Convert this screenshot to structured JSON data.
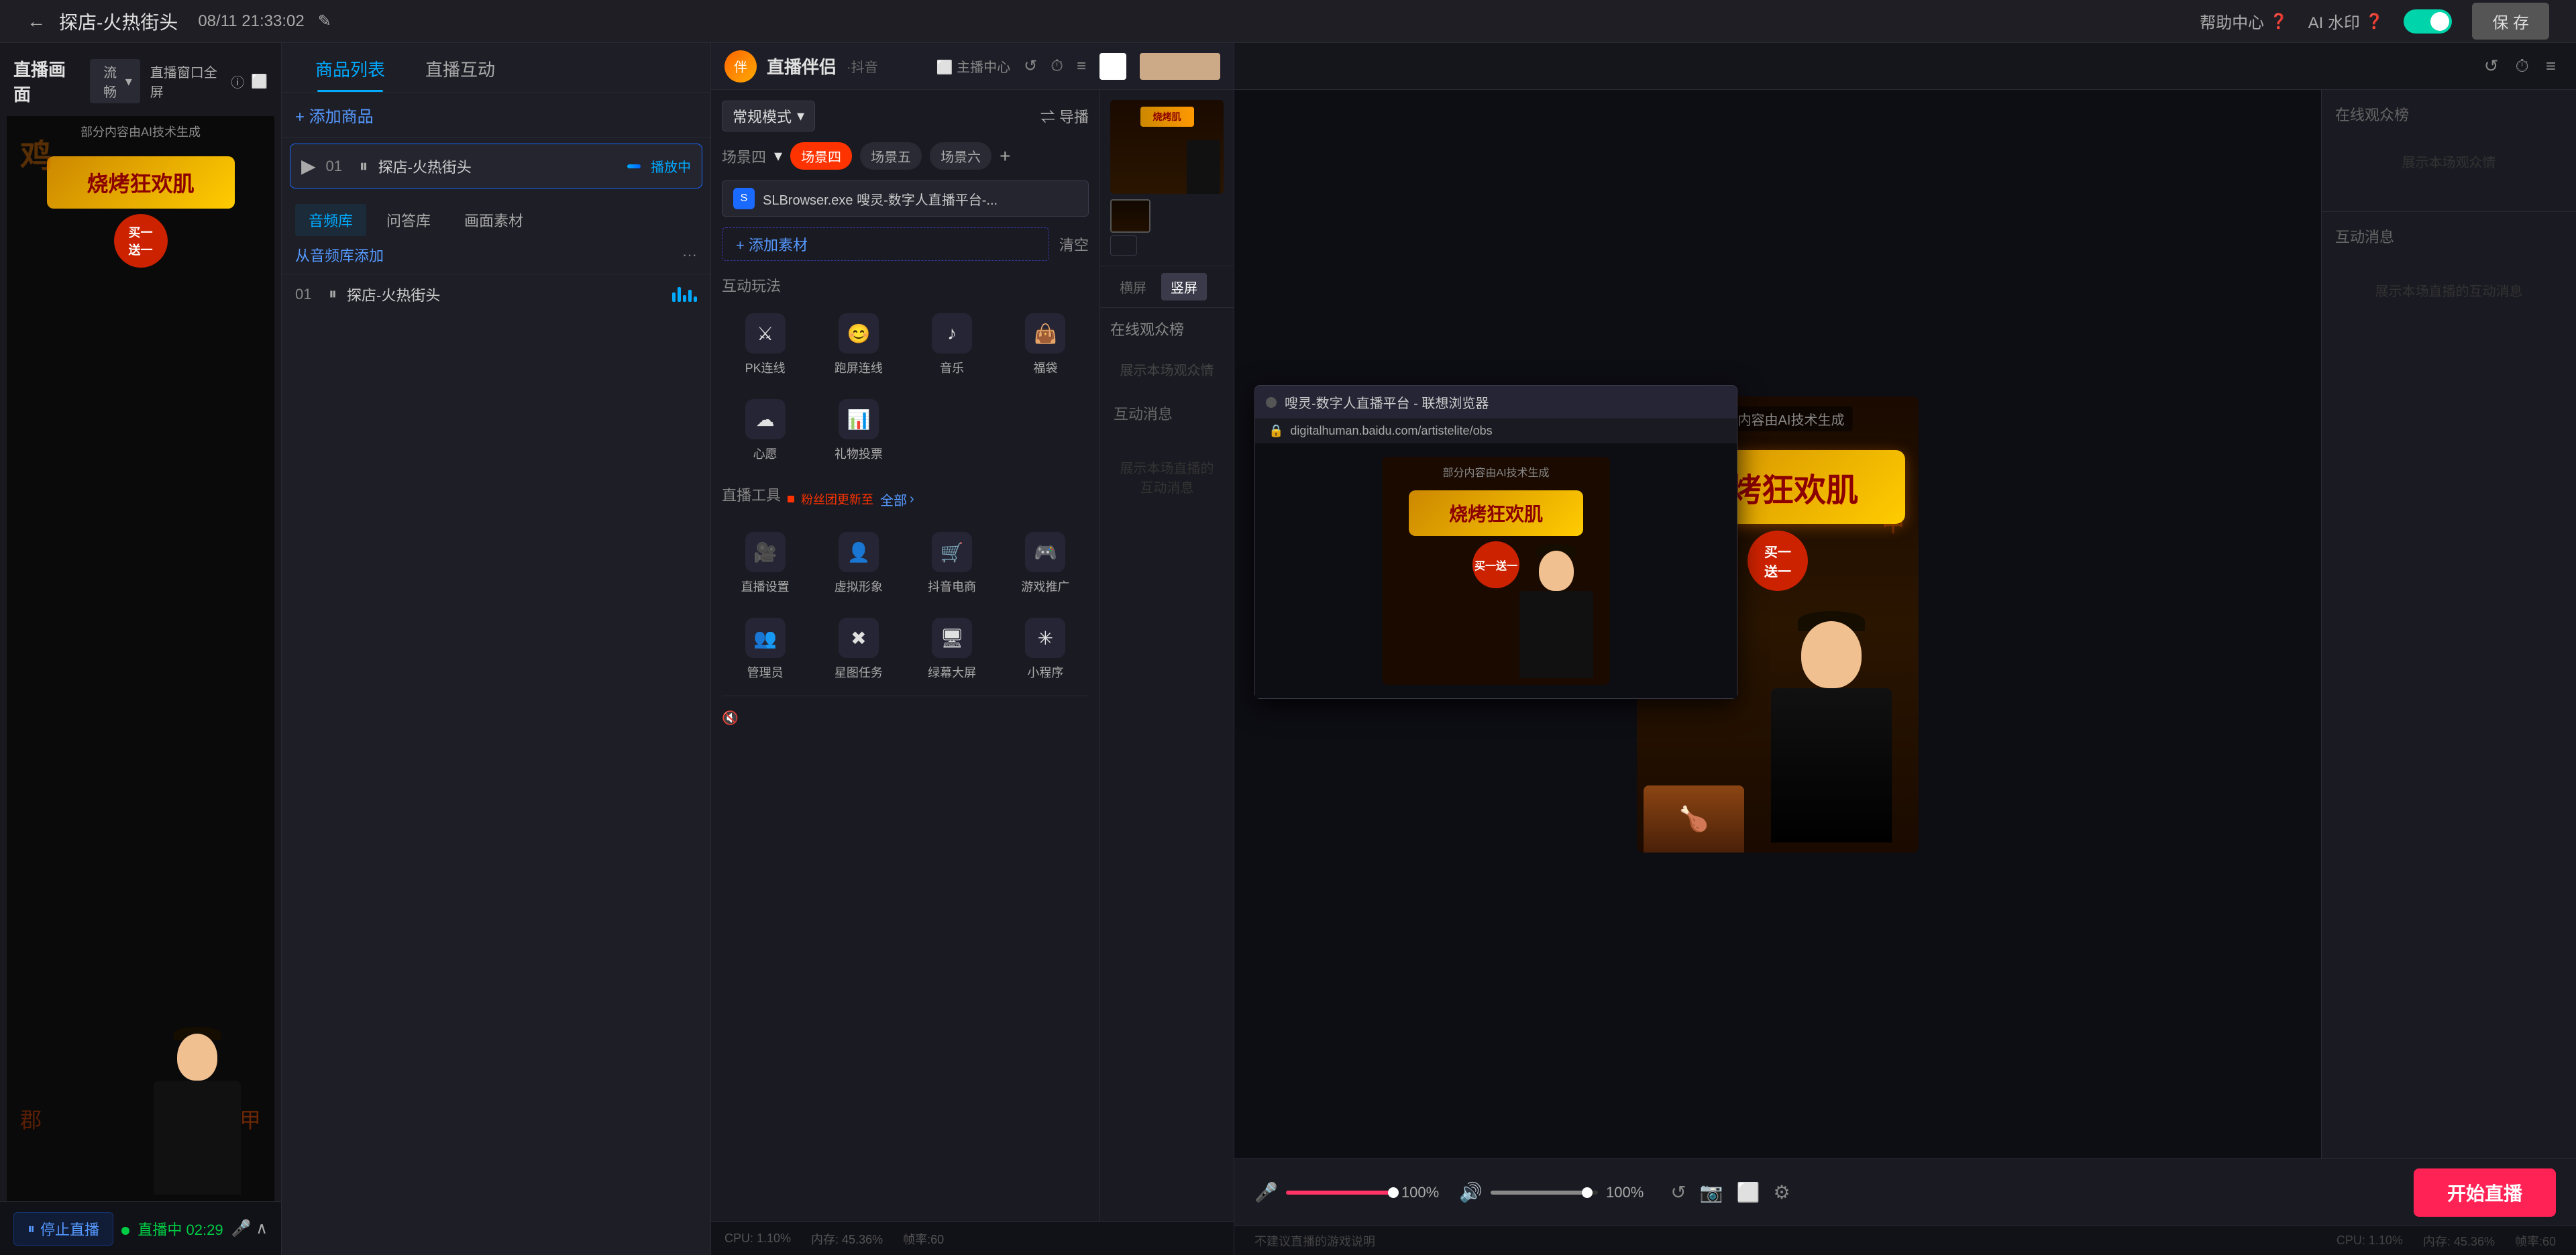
{
  "topbar": {
    "back_label": "←",
    "title": "探店-火热街头",
    "datetime": "08/11 21:33:02",
    "edit_icon": "✎",
    "help_label": "帮助中心",
    "ai_watermark_label": "AI 水印",
    "save_label": "保 存"
  },
  "left_panel": {
    "title": "直播画面",
    "quality_label": "流畅",
    "fullscreen_label": "直播窗口全屏",
    "preview_ai_label": "部分内容由AI技术生成",
    "stop_live_label": "停止直播",
    "duration_label": "直播中 02:29"
  },
  "middle_panel": {
    "tabs": [
      "商品列表",
      "直播互动"
    ],
    "active_tab": 0,
    "add_product_label": "+ 添加商品",
    "products": [
      {
        "num": "01",
        "name": "探店-火热街头",
        "badge": "播放中"
      }
    ],
    "section_tabs": [
      "音频库",
      "问答库",
      "画面素材"
    ],
    "from_library": "从音频库添加",
    "audio_items": [
      {
        "num": "01",
        "name": "探店-火热街头"
      }
    ]
  },
  "companion_panel": {
    "logo_text": "伴",
    "title": "直播伴侣",
    "sub_label": "·抖音",
    "mode_label": "常规模式",
    "guide_label": "⇌ 导播",
    "scene_label": "场景四",
    "scenes": [
      "场景四",
      "场景五",
      "场景六"
    ],
    "active_scene": 0,
    "app_notif": "SLBrowser.exe 嗖灵-数字人直播平台-...",
    "add_material_label": "+ 添加素材",
    "clear_label": "清空",
    "interaction_title": "互动玩法",
    "interactions": [
      {
        "label": "PK连线",
        "icon": "⚔"
      },
      {
        "label": "跑屏连线",
        "icon": "😊"
      },
      {
        "label": "音乐",
        "icon": "♪"
      },
      {
        "label": "福袋",
        "icon": "👤"
      },
      {
        "label": "心愿",
        "icon": "☁"
      },
      {
        "label": "礼物投票",
        "icon": "📊"
      }
    ],
    "tools_title": "直播工具",
    "tools_new_label": "粉丝团更新至",
    "tools_all_label": "全部",
    "tools": [
      {
        "label": "直播设置",
        "icon": "🎥"
      },
      {
        "label": "虚拟形象",
        "icon": "👤"
      },
      {
        "label": "抖音电商",
        "icon": "🛒"
      },
      {
        "label": "游戏推广",
        "icon": "🎮"
      },
      {
        "label": "管理员",
        "icon": "👥"
      },
      {
        "label": "星图任务",
        "icon": "✖"
      },
      {
        "label": "绿幕大屏",
        "icon": "🖥"
      },
      {
        "label": "小程序",
        "icon": "✳"
      }
    ],
    "right_view_buttons": [
      "横屏",
      "竖屏"
    ],
    "online_viewers_title": "在线观众榜",
    "show_viewers_label": "展示本场观众情",
    "interact_msg_title": "互动消息",
    "interact_msg_placeholder": "展示本场直播的互动消息"
  },
  "right_panel": {
    "ai_label": "部分内容由AI技术生成",
    "sign_text": "烧烤狂欢肌",
    "sign_promo": "买一送一",
    "vol_mic_pct": "100%",
    "vol_speaker_pct": "100%",
    "start_live_label": "开始直播",
    "stats_label": "不建议直播的游戏说明",
    "cpu_label": "CPU: 1.10%",
    "mem_label": "内存: 45.36%",
    "fps_label": "帧率:60"
  },
  "browser_popup": {
    "title": "嗖灵-数字人直播平台 - 联想浏览器",
    "url": "digitalhuman.baidu.com/artistelite/obs",
    "ai_label": "部分内容由AI技术生成",
    "sign_text": "烧烤狂欢肌",
    "sign_sub": "买一送一"
  }
}
